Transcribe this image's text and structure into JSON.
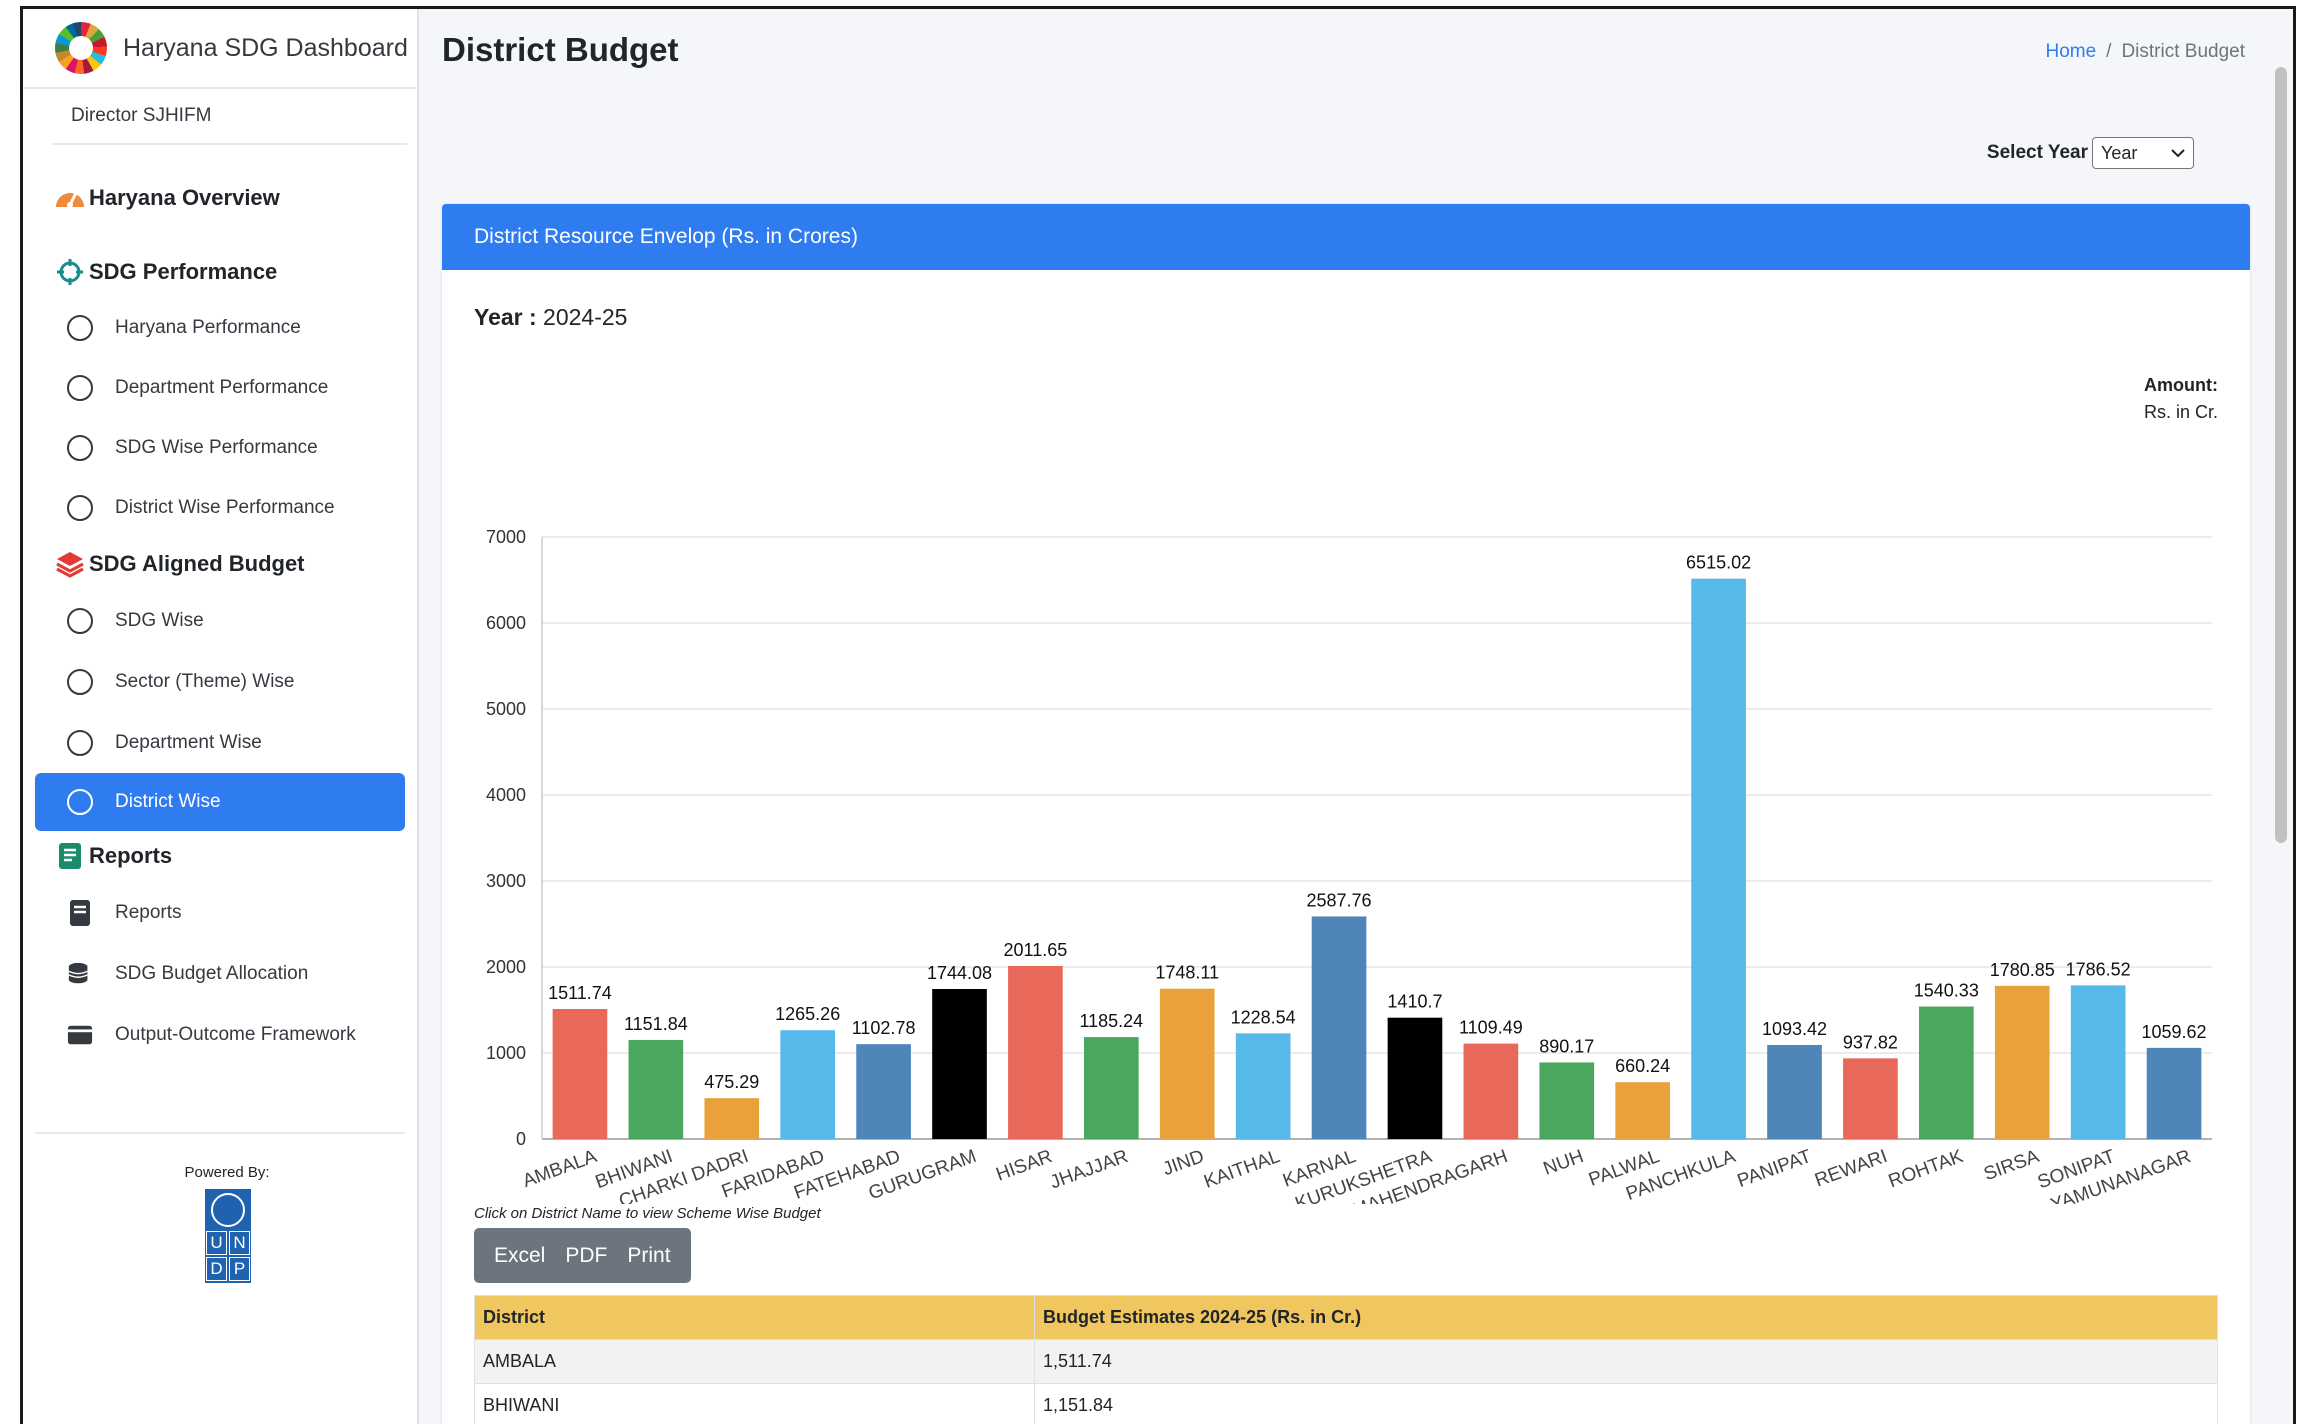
{
  "sidebar": {
    "brand_title": "Haryana SDG Dashboard",
    "user": "Director SJHIFM",
    "overview": "Haryana Overview",
    "perf_section": "SDG Performance",
    "perf_items": [
      "Haryana Performance",
      "Department Performance",
      "SDG Wise Performance",
      "District Wise Performance"
    ],
    "budget_section": "SDG Aligned Budget",
    "budget_items": [
      "SDG Wise",
      "Sector (Theme) Wise",
      "Department Wise",
      "District Wise"
    ],
    "reports_section": "Reports",
    "report_items": [
      "Reports",
      "SDG Budget Allocation",
      "Output-Outcome Framework"
    ],
    "powered_by": "Powered By:",
    "undp_letters": [
      "U",
      "N",
      "D",
      "P"
    ]
  },
  "header": {
    "page_title": "District Budget",
    "breadcrumb_home": "Home",
    "breadcrumb_sep": "/",
    "breadcrumb_current": "District Budget"
  },
  "filter": {
    "label": "Select Year",
    "value": "Year"
  },
  "card": {
    "title": "District Resource Envelop (Rs. in Crores)",
    "year_label": "Year :",
    "year_value": "2024-25",
    "amount_label": "Amount:",
    "amount_unit": "Rs. in Cr.",
    "hint": "Click on District Name to view Scheme Wise Budget",
    "buttons": [
      "Excel",
      "PDF",
      "Print"
    ]
  },
  "colors": {
    "accent": "#2f7cf0",
    "table_header": "#f0c75e",
    "bar_palette": [
      "#e8685a",
      "#4aa85e",
      "#e9a23b",
      "#56b9e9",
      "#4f86b9",
      "#000000"
    ]
  },
  "chart_data": {
    "type": "bar",
    "categories": [
      "AMBALA",
      "BHIWANI",
      "CHARKI DADRI",
      "FARIDABAD",
      "FATEHABAD",
      "GURUGRAM",
      "HISAR",
      "JHAJJAR",
      "JIND",
      "KAITHAL",
      "KARNAL",
      "KURUKSHETRA",
      "MAHENDRAGARH",
      "NUH",
      "PALWAL",
      "PANCHKULA",
      "PANIPAT",
      "REWARI",
      "ROHTAK",
      "SIRSA",
      "SONIPAT",
      "YAMUNANAGAR"
    ],
    "values": [
      1511.74,
      1151.84,
      475.29,
      1265.26,
      1102.78,
      1744.08,
      2011.65,
      1185.24,
      1748.11,
      1228.54,
      2587.76,
      1410.7,
      1109.49,
      890.17,
      660.24,
      6515.02,
      1093.42,
      937.82,
      1540.33,
      1780.85,
      1786.52,
      1059.62
    ],
    "bar_colors": [
      "#e8685a",
      "#4aa85e",
      "#e9a23b",
      "#56b9e9",
      "#4f86b9",
      "#000000",
      "#e8685a",
      "#4aa85e",
      "#e9a23b",
      "#56b9e9",
      "#4f86b9",
      "#000000",
      "#e8685a",
      "#4aa85e",
      "#e9a23b",
      "#56b9e9",
      "#4f86b9",
      "#e8685a",
      "#4aa85e",
      "#e9a23b",
      "#56b9e9",
      "#4f86b9"
    ],
    "yticks": [
      0,
      1000,
      2000,
      3000,
      4000,
      5000,
      6000,
      7000
    ],
    "ylim": [
      0,
      7000
    ],
    "grid": true,
    "xlabel": "",
    "ylabel": ""
  },
  "table": {
    "headers": [
      "District",
      "Budget Estimates 2024-25 (Rs. in Cr.)"
    ],
    "rows": [
      [
        "AMBALA",
        "1,511.74"
      ],
      [
        "BHIWANI",
        "1,151.84"
      ]
    ]
  }
}
